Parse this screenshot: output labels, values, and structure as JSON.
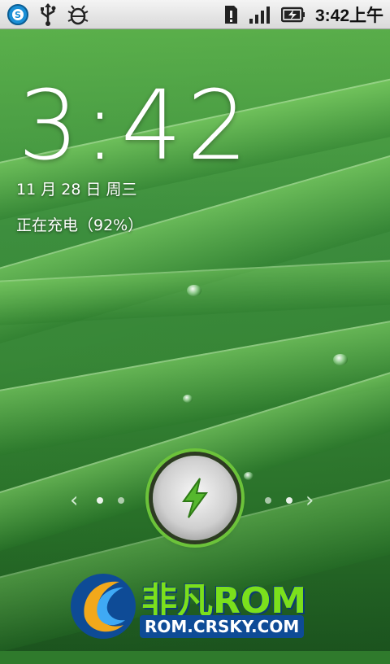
{
  "status_bar": {
    "icons_left": [
      "app-logo-icon",
      "usb-icon",
      "debug-bug-icon"
    ],
    "icons_right": [
      "sd-card-alert-icon",
      "signal-icon",
      "battery-charging-icon"
    ],
    "time": "3:42上午"
  },
  "lockscreen": {
    "clock": "3:42",
    "date": "11 月 28 日 周三",
    "charging_status": "正在充电（92%）",
    "unlock_icon": "lightning-icon",
    "accent_color": "#6cc33a"
  },
  "watermark": {
    "line1": "非凡ROM",
    "line2": "ROM.CRSKY.COM"
  }
}
